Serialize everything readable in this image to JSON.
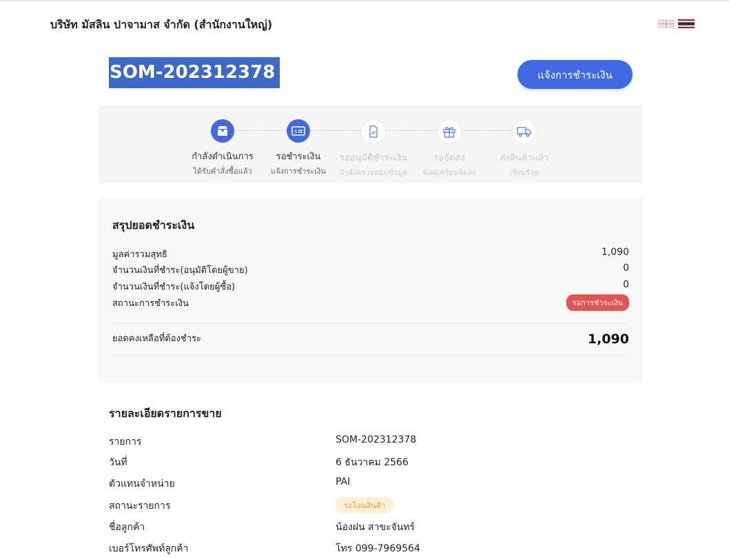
{
  "header": {
    "company_name": "บริษัท มัสลิน ปาจามาส จำกัด (สำนักงานใหญ่)",
    "languages": [
      {
        "code": "en",
        "icon": "uk-flag-icon"
      },
      {
        "code": "th",
        "icon": "thai-flag-icon"
      }
    ]
  },
  "order": {
    "id": "SOM-202312378",
    "notify_payment_label": "แจ้งการชำระเงิน"
  },
  "progress": {
    "steps": [
      {
        "title": "กำลังดำเนินการ",
        "subtitle": "ได้รับคำสั่งซื้อแล้ว",
        "icon": "box-icon",
        "active": true
      },
      {
        "title": "รอชำระเงิน",
        "subtitle": "แจ้งการชำระเงิน",
        "icon": "payment-card-icon",
        "active": true
      },
      {
        "title": "รออนุมัติชำระเงิน",
        "subtitle": "กำลังตรวจสอบข้อมูล",
        "icon": "document-check-icon",
        "active": false
      },
      {
        "title": "รอจัดส่ง",
        "subtitle": "พัสดุเตรียมจัดส่ง",
        "icon": "gift-box-icon",
        "active": false
      },
      {
        "title": "ส่งสินค้าแล้ว",
        "subtitle": "เรียบร้อย",
        "icon": "delivery-truck-icon",
        "active": false
      }
    ]
  },
  "summary": {
    "title": "สรุปยอดชำระเงิน",
    "rows": [
      {
        "label": "มูลค่ารวมสุทธิ",
        "value": "1,090"
      },
      {
        "label": "จำนวนเงินที่ชำระ(อนุมัติโดยผู้ขาย)",
        "value": "0"
      },
      {
        "label": "จำนวนเงินที่ชำระ(แจ้งโดยผู้ซื้อ)",
        "value": "0"
      }
    ],
    "payment_status_label": "สถานะการชำระเงิน",
    "payment_status_value": "รอการชำระเงิน",
    "balance_label": "ยอดคงเหลือที่ต้องชำระ",
    "balance_value": "1,090",
    "colors": {
      "status_badge": "#e35353",
      "accent": "#4169e1"
    }
  },
  "details": {
    "title": "รายละเอียดรายการขาย",
    "rows": [
      {
        "label": "รายการ",
        "value": "SOM-202312378"
      },
      {
        "label": "วันที่",
        "value": "6 ธันวาคม 2566"
      },
      {
        "label": "ตัวแทนจำหน่าย",
        "value": "PAI"
      },
      {
        "label": "สถานะรายการ",
        "value": "รอโอนสินค้า"
      },
      {
        "label": "ชื่อลูกค้า",
        "value": "น้องฝน สาขะจันทร์"
      },
      {
        "label": "เบอร์โทรศัพท์ลูกค้า",
        "value": "โทร 099-7969564"
      }
    ]
  }
}
